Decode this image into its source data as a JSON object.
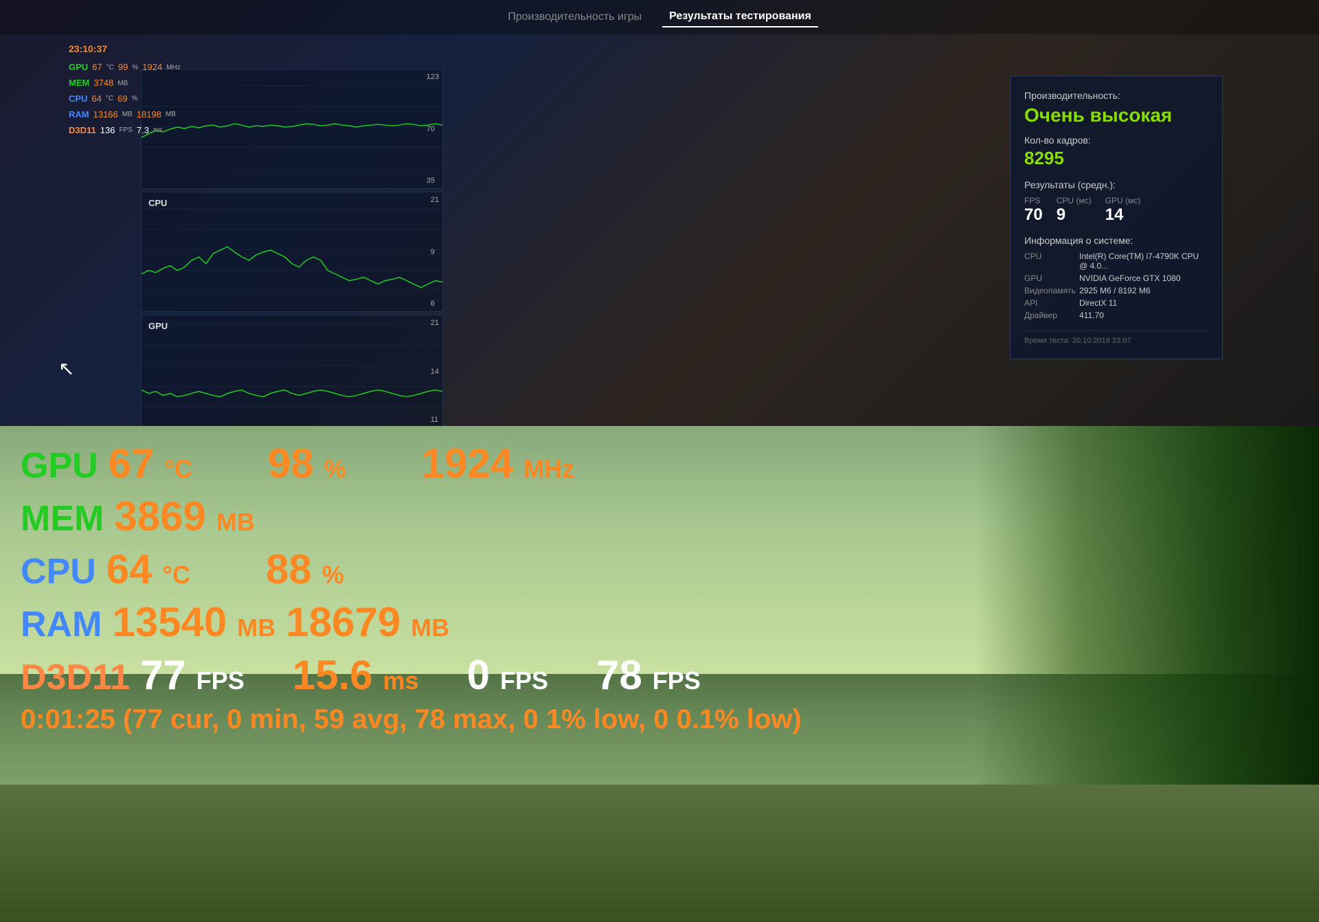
{
  "tabs": {
    "performance": "Производительность игры",
    "results": "Результаты тестирования"
  },
  "overlay_small": {
    "timestamp": "23:10:37",
    "gpu_label": "GPU",
    "gpu_temp": "67",
    "gpu_temp_unit": "°C",
    "gpu_load": "99",
    "gpu_load_unit": "%",
    "gpu_clock": "1924",
    "gpu_clock_unit": "MHz",
    "mem_label": "MEM",
    "mem_val": "3748",
    "mem_unit": "MB",
    "cpu_label": "CPU",
    "cpu_temp": "64",
    "cpu_temp_unit": "°C",
    "cpu_load": "69",
    "cpu_load_unit": "%",
    "ram_label": "RAM",
    "ram_val": "13166",
    "ram_unit": "MB",
    "ram_val2": "18198",
    "ram_unit2": "MB",
    "d3d_label": "D3D11",
    "d3d_fps": "136",
    "d3d_fps_unit": "FPS",
    "d3d_ms": "7.3",
    "d3d_ms_unit": "ms"
  },
  "charts": {
    "cpu_label": "CPU",
    "gpu_label": "GPU",
    "fps_top_max": "123",
    "fps_top_mid": "70",
    "fps_top_low": "35",
    "cpu_max": "21",
    "cpu_mid": "9",
    "cpu_low": "6",
    "gpu_max": "21",
    "gpu_mid": "14",
    "gpu_low": "11"
  },
  "results": {
    "performance_label": "Производительность:",
    "rating": "Очень высокая",
    "frames_label": "Кол-во кадров:",
    "frames_value": "8295",
    "avg_label": "Результаты (средн.):",
    "fps_label": "FPS",
    "fps_value": "70",
    "cpu_label": "CPU (мс)",
    "cpu_value": "9",
    "gpu_label": "GPU (мс)",
    "gpu_value": "14",
    "system_label": "Информация о системе:",
    "cpu_key": "CPU",
    "cpu_val": "Intel(R) Core(TM) i7-4790K CPU @ 4.0...",
    "gpu_key": "GPU",
    "gpu_val": "NVIDIA GeForce GTX 1080",
    "vram_key": "Видеопамять",
    "vram_val": "2925 М6 / 8192 М6",
    "api_key": "API",
    "api_val": "DirectX 11",
    "driver_key": "Драйвер",
    "driver_val": "411.70",
    "test_time": "Время теста: 20.10.2018 23:07"
  },
  "overlay_large": {
    "gpu_label": "GPU",
    "gpu_temp": "67",
    "gpu_temp_unit": "°C",
    "gpu_load": "98",
    "gpu_load_unit": "%",
    "gpu_clock": "1924",
    "gpu_clock_unit": "MHz",
    "mem_label": "MEM",
    "mem_val": "3869",
    "mem_unit": "MB",
    "cpu_label": "CPU",
    "cpu_temp": "64",
    "cpu_temp_unit": "°C",
    "cpu_load": "88",
    "cpu_load_unit": "%",
    "ram_label": "RAM",
    "ram_val": "13540",
    "ram_unit": "MB",
    "ram_val2": "18679",
    "ram_unit2": "MB",
    "d3d_label": "D3D11",
    "d3d_fps": "77",
    "d3d_fps_unit": "FPS",
    "d3d_ms": "15.6",
    "d3d_ms_unit": "ms",
    "d3d_0fps": "0",
    "d3d_0fps_unit": "FPS",
    "d3d_78fps": "78",
    "d3d_78fps_unit": "FPS",
    "summary": "0:01:25 (77 cur, 0 min, 59 avg, 78 max, 0 1% low, 0 0.1% low)"
  }
}
